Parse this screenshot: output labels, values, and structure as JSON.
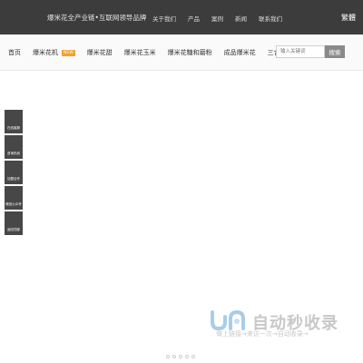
{
  "header": {
    "slogan": "爆米花全产业链•互联网领导品牌",
    "links": [
      "关于我们",
      "产品",
      "案例",
      "新闻",
      "联系我们"
    ],
    "language_toggle": "繁體",
    "background_color": "#3c3c3c"
  },
  "nav": {
    "items": [
      {
        "label": "首页"
      },
      {
        "label": "爆米花机",
        "badge": "NEW"
      },
      {
        "label": "爆米花甜"
      },
      {
        "label": "爆米花玉米"
      },
      {
        "label": "爆米花糖和磨粉"
      },
      {
        "label": "成品爆米花"
      },
      {
        "label": "三合一爆米花"
      }
    ],
    "badge_color": "#f0a030"
  },
  "search": {
    "placeholder": "输入关键词",
    "button_label": "搜索"
  },
  "sidebar": {
    "buttons": [
      "在线客服",
      "咨询热线",
      "加盟合作",
      "微信公众号",
      "返回顶部"
    ],
    "color": "#474747"
  },
  "watermark": {
    "title": "自动秒收录",
    "subtitle": "做上链接→来访一次→自动收录→"
  },
  "slider": {
    "dot_count": 5
  }
}
